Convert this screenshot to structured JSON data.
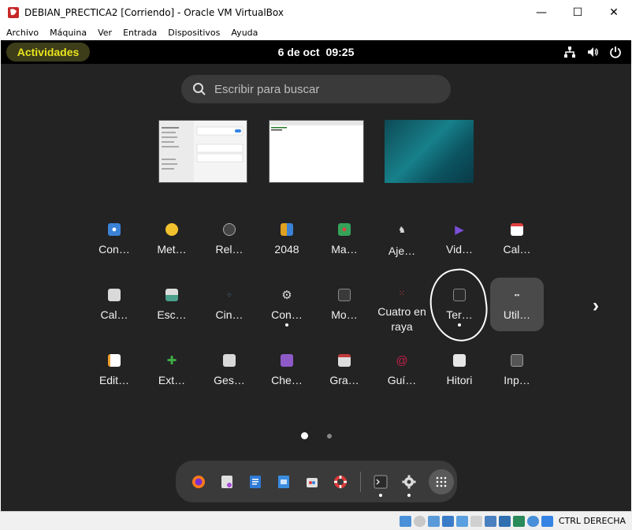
{
  "window": {
    "title": "DEBIAN_PRECTICA2 [Corriendo] - Oracle VM VirtualBox",
    "minimize": "—",
    "maximize": "☐",
    "close": "✕"
  },
  "menu": [
    "Archivo",
    "Máquina",
    "Ver",
    "Entrada",
    "Dispositivos",
    "Ayuda"
  ],
  "topbar": {
    "activities": "Actividades",
    "date": "6 de oct",
    "time": "09:25"
  },
  "search": {
    "placeholder": "Escribir para buscar"
  },
  "apps": [
    {
      "label": "Con…",
      "icon": "contacts-icon",
      "color": "#3b82d6"
    },
    {
      "label": "Met…",
      "icon": "weather-icon",
      "color": "#f2c12e"
    },
    {
      "label": "Rel…",
      "icon": "clock-icon",
      "color": "#444444"
    },
    {
      "label": "2048",
      "icon": "2048-icon",
      "color": "#e0a020"
    },
    {
      "label": "Ma…",
      "icon": "maps-icon",
      "color": "#35a35a"
    },
    {
      "label": "Aje…",
      "icon": "chess-icon",
      "color": "#cccccc"
    },
    {
      "label": "Vid…",
      "icon": "videos-icon",
      "color": "#7b4ed8"
    },
    {
      "label": "Cal…",
      "icon": "calendar-icon",
      "color": "#ffffff"
    },
    {
      "label": "Cal…",
      "icon": "calculator-icon",
      "color": "#d9d9d9"
    },
    {
      "label": "Esc…",
      "icon": "scanner-icon",
      "color": "#4aa08a"
    },
    {
      "label": "Cin…",
      "icon": "cinnamon-dots-icon",
      "color": "#5a9ae0"
    },
    {
      "label": "Con…",
      "icon": "settings-icon",
      "color": "#dddddd"
    },
    {
      "label": "Mo…",
      "icon": "system-monitor-icon",
      "color": "#3a3a3a"
    },
    {
      "label": "Cuatro en raya",
      "icon": "four-in-a-row-icon",
      "color": "#2e8b3a"
    },
    {
      "label": "Ter…",
      "icon": "terminal-icon",
      "color": "#2a2a2a"
    },
    {
      "label": "Util…",
      "icon": "utilities-folder-icon",
      "color": "#4a4a4a"
    },
    {
      "label": "Edit…",
      "icon": "text-editor-icon",
      "color": "#f0a030"
    },
    {
      "label": "Ext…",
      "icon": "extensions-icon",
      "color": "#3fae45"
    },
    {
      "label": "Ges…",
      "icon": "software-icon",
      "color": "#d8d8d8"
    },
    {
      "label": "Che…",
      "icon": "cheese-icon",
      "color": "#8e5ac8"
    },
    {
      "label": "Gra…",
      "icon": "recorder-icon",
      "color": "#c23b3b"
    },
    {
      "label": "Guí…",
      "icon": "debian-help-icon",
      "color": "#c7204a"
    },
    {
      "label": "Hitori",
      "icon": "hitori-icon",
      "color": "#e6e6e6"
    },
    {
      "label": "Inp…",
      "icon": "input-method-icon",
      "color": "#555555"
    }
  ],
  "pagination": {
    "pages": 2,
    "current": 1
  },
  "dash": [
    {
      "name": "firefox-icon",
      "color": "#ff7a1a",
      "running": false
    },
    {
      "name": "files-icon",
      "color": "#e0e0e0",
      "running": false
    },
    {
      "name": "writer-icon",
      "color": "#2f7ad6",
      "running": false
    },
    {
      "name": "document-icon",
      "color": "#3b8de0",
      "running": false
    },
    {
      "name": "software-center-icon",
      "color": "#e0e0e0",
      "running": false
    },
    {
      "name": "help-lifebuoy-icon",
      "color": "#e03a3a",
      "running": false
    },
    {
      "name": "terminal-icon",
      "color": "#2a2a2a",
      "running": true
    },
    {
      "name": "settings-icon",
      "color": "#dddddd",
      "running": true
    }
  ],
  "statusbar": {
    "hostkey": "CTRL DERECHA"
  }
}
